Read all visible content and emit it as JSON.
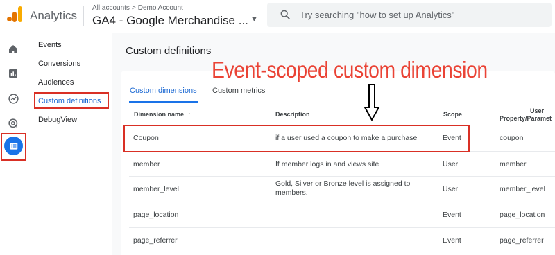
{
  "header": {
    "app_name": "Analytics",
    "breadcrumb": [
      "All accounts",
      "Demo Account"
    ],
    "breadcrumb_sep": ">",
    "property_name": "GA4 - Google Merchandise ...",
    "search_placeholder": "Try searching \"how to set up Analytics\""
  },
  "rail": {
    "icons": [
      "home-icon",
      "reports-icon",
      "explore-icon",
      "advertising-icon",
      "configure-icon"
    ],
    "active": "configure-icon",
    "active_color": "#1a73e8"
  },
  "subnav": {
    "items": [
      "Events",
      "Conversions",
      "Audiences",
      "Custom definitions",
      "DebugView"
    ],
    "active": "Custom definitions"
  },
  "main": {
    "title": "Custom definitions",
    "tabs": [
      "Custom dimensions",
      "Custom metrics"
    ],
    "active_tab": "Custom dimensions",
    "columns": {
      "name": "Dimension name",
      "sort_arrow": "↑",
      "description": "Description",
      "scope": "Scope",
      "user_property_line1": "User",
      "user_property_line2": "Property/Paramet"
    },
    "rows": [
      {
        "name": "Coupon",
        "description": "if a user used a coupon to make a purchase",
        "scope": "Event",
        "param": "coupon"
      },
      {
        "name": "member",
        "description": "If member logs in and views site",
        "scope": "User",
        "param": "member"
      },
      {
        "name": "member_level",
        "description": "Gold, Silver or Bronze level is assigned to members.",
        "scope": "User",
        "param": "member_level"
      },
      {
        "name": "page_location",
        "description": "",
        "scope": "Event",
        "param": "page_location"
      },
      {
        "name": "page_referrer",
        "description": "",
        "scope": "Event",
        "param": "page_referrer"
      }
    ]
  },
  "annotation": {
    "text": "Event-scoped custom dimension",
    "color": "#ea4335"
  },
  "colors": {
    "accent": "#1a73e8",
    "highlight_border": "#d93025",
    "logo_orange": "#e37400",
    "logo_yellow": "#f9ab00"
  }
}
